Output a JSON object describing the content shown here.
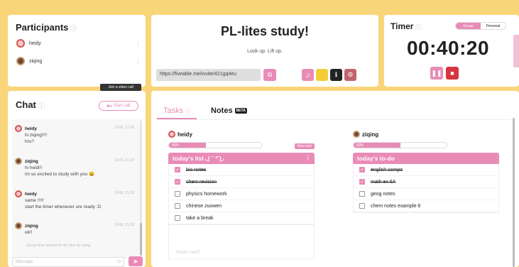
{
  "participants": {
    "title": "Participants",
    "users": [
      {
        "name": "heidy"
      },
      {
        "name": "ziqing"
      }
    ]
  },
  "chat": {
    "title": "Chat",
    "start_call_label": "Start call",
    "tooltip": "Join a video call",
    "messages": [
      {
        "sender": "heidy",
        "time": "10:06, 21:30",
        "lines": [
          "hi ziqing!!!!",
          "hru?"
        ]
      },
      {
        "sender": "ziqing",
        "time": "10:06, 21:30",
        "lines": [
          "hi heidi!!",
          "im so excited to study with you 😀"
        ]
      },
      {
        "sender": "heidy",
        "time": "10:06, 21:30",
        "lines": [
          "same !!!!!",
          "start the timer whenever ure ready :D"
        ]
      },
      {
        "sender": "ziqing",
        "time": "10:06, 21:30",
        "lines": [
          "ok!!"
        ]
      }
    ],
    "system_message": "Group timer started for 40 mins by ziqing",
    "input_placeholder": "Message"
  },
  "study": {
    "title": "PL-lites study!",
    "subtitle": "Look up. Lift up.",
    "invite_link": "https://fiveable.me/invite/421gq4eu"
  },
  "timer": {
    "title": "Timer",
    "modes": [
      "Group",
      "Personal"
    ],
    "active_mode": "Group",
    "time": "00:40:20"
  },
  "workspace": {
    "tabs": [
      "Tasks",
      "Notes"
    ],
    "active_tab": "Tasks",
    "beta_label": "BETA",
    "whats_next_placeholder": "What's next?",
    "lists": [
      {
        "owner": "heidy",
        "progress_label": "40%",
        "progress": 0.4,
        "new_task_label": "New task",
        "title": "today's list ◟( ˘ ³˘)◞",
        "tasks": [
          {
            "text": "bio notes",
            "done": true
          },
          {
            "text": "chem revision",
            "done": true
          },
          {
            "text": "physics homework",
            "done": false
          },
          {
            "text": "chinese zuowen",
            "done": false
          },
          {
            "text": "take a break",
            "done": false
          }
        ]
      },
      {
        "owner": "ziqing",
        "progress_label": "50%",
        "progress": 0.5,
        "title": "today's to-do ",
        "tasks": [
          {
            "text": "english compo",
            "done": true
          },
          {
            "text": "math ex 6A",
            "done": true
          },
          {
            "text": "geog notes",
            "done": false
          },
          {
            "text": "chem notes example 6",
            "done": false
          }
        ]
      }
    ]
  },
  "colors": {
    "background": "#f9d57a",
    "accent": "#e98bb7",
    "stop": "#d7353f"
  }
}
